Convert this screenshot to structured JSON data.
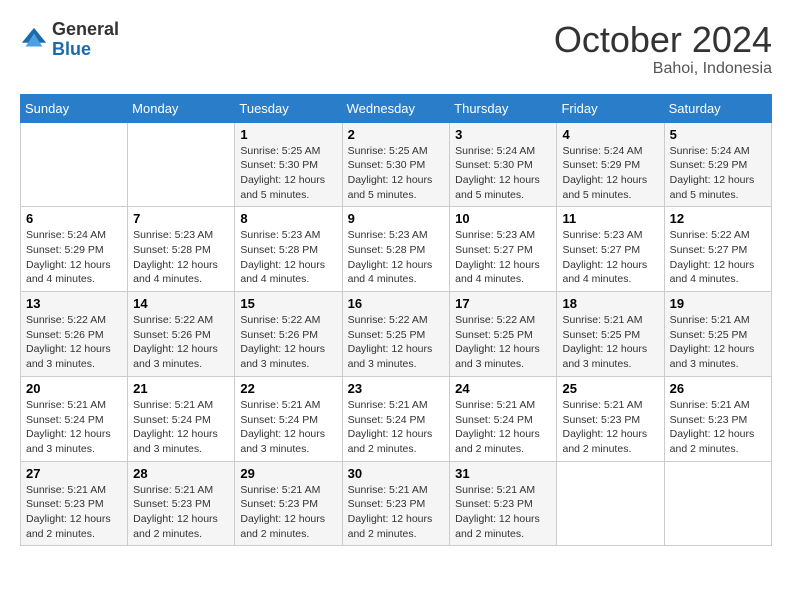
{
  "header": {
    "logo_general": "General",
    "logo_blue": "Blue",
    "month_title": "October 2024",
    "location": "Bahoi, Indonesia"
  },
  "weekdays": [
    "Sunday",
    "Monday",
    "Tuesday",
    "Wednesday",
    "Thursday",
    "Friday",
    "Saturday"
  ],
  "weeks": [
    [
      {
        "day": "",
        "info": ""
      },
      {
        "day": "",
        "info": ""
      },
      {
        "day": "1",
        "info": "Sunrise: 5:25 AM\nSunset: 5:30 PM\nDaylight: 12 hours and 5 minutes."
      },
      {
        "day": "2",
        "info": "Sunrise: 5:25 AM\nSunset: 5:30 PM\nDaylight: 12 hours and 5 minutes."
      },
      {
        "day": "3",
        "info": "Sunrise: 5:24 AM\nSunset: 5:30 PM\nDaylight: 12 hours and 5 minutes."
      },
      {
        "day": "4",
        "info": "Sunrise: 5:24 AM\nSunset: 5:29 PM\nDaylight: 12 hours and 5 minutes."
      },
      {
        "day": "5",
        "info": "Sunrise: 5:24 AM\nSunset: 5:29 PM\nDaylight: 12 hours and 5 minutes."
      }
    ],
    [
      {
        "day": "6",
        "info": "Sunrise: 5:24 AM\nSunset: 5:29 PM\nDaylight: 12 hours and 4 minutes."
      },
      {
        "day": "7",
        "info": "Sunrise: 5:23 AM\nSunset: 5:28 PM\nDaylight: 12 hours and 4 minutes."
      },
      {
        "day": "8",
        "info": "Sunrise: 5:23 AM\nSunset: 5:28 PM\nDaylight: 12 hours and 4 minutes."
      },
      {
        "day": "9",
        "info": "Sunrise: 5:23 AM\nSunset: 5:28 PM\nDaylight: 12 hours and 4 minutes."
      },
      {
        "day": "10",
        "info": "Sunrise: 5:23 AM\nSunset: 5:27 PM\nDaylight: 12 hours and 4 minutes."
      },
      {
        "day": "11",
        "info": "Sunrise: 5:23 AM\nSunset: 5:27 PM\nDaylight: 12 hours and 4 minutes."
      },
      {
        "day": "12",
        "info": "Sunrise: 5:22 AM\nSunset: 5:27 PM\nDaylight: 12 hours and 4 minutes."
      }
    ],
    [
      {
        "day": "13",
        "info": "Sunrise: 5:22 AM\nSunset: 5:26 PM\nDaylight: 12 hours and 3 minutes."
      },
      {
        "day": "14",
        "info": "Sunrise: 5:22 AM\nSunset: 5:26 PM\nDaylight: 12 hours and 3 minutes."
      },
      {
        "day": "15",
        "info": "Sunrise: 5:22 AM\nSunset: 5:26 PM\nDaylight: 12 hours and 3 minutes."
      },
      {
        "day": "16",
        "info": "Sunrise: 5:22 AM\nSunset: 5:25 PM\nDaylight: 12 hours and 3 minutes."
      },
      {
        "day": "17",
        "info": "Sunrise: 5:22 AM\nSunset: 5:25 PM\nDaylight: 12 hours and 3 minutes."
      },
      {
        "day": "18",
        "info": "Sunrise: 5:21 AM\nSunset: 5:25 PM\nDaylight: 12 hours and 3 minutes."
      },
      {
        "day": "19",
        "info": "Sunrise: 5:21 AM\nSunset: 5:25 PM\nDaylight: 12 hours and 3 minutes."
      }
    ],
    [
      {
        "day": "20",
        "info": "Sunrise: 5:21 AM\nSunset: 5:24 PM\nDaylight: 12 hours and 3 minutes."
      },
      {
        "day": "21",
        "info": "Sunrise: 5:21 AM\nSunset: 5:24 PM\nDaylight: 12 hours and 3 minutes."
      },
      {
        "day": "22",
        "info": "Sunrise: 5:21 AM\nSunset: 5:24 PM\nDaylight: 12 hours and 3 minutes."
      },
      {
        "day": "23",
        "info": "Sunrise: 5:21 AM\nSunset: 5:24 PM\nDaylight: 12 hours and 2 minutes."
      },
      {
        "day": "24",
        "info": "Sunrise: 5:21 AM\nSunset: 5:24 PM\nDaylight: 12 hours and 2 minutes."
      },
      {
        "day": "25",
        "info": "Sunrise: 5:21 AM\nSunset: 5:23 PM\nDaylight: 12 hours and 2 minutes."
      },
      {
        "day": "26",
        "info": "Sunrise: 5:21 AM\nSunset: 5:23 PM\nDaylight: 12 hours and 2 minutes."
      }
    ],
    [
      {
        "day": "27",
        "info": "Sunrise: 5:21 AM\nSunset: 5:23 PM\nDaylight: 12 hours and 2 minutes."
      },
      {
        "day": "28",
        "info": "Sunrise: 5:21 AM\nSunset: 5:23 PM\nDaylight: 12 hours and 2 minutes."
      },
      {
        "day": "29",
        "info": "Sunrise: 5:21 AM\nSunset: 5:23 PM\nDaylight: 12 hours and 2 minutes."
      },
      {
        "day": "30",
        "info": "Sunrise: 5:21 AM\nSunset: 5:23 PM\nDaylight: 12 hours and 2 minutes."
      },
      {
        "day": "31",
        "info": "Sunrise: 5:21 AM\nSunset: 5:23 PM\nDaylight: 12 hours and 2 minutes."
      },
      {
        "day": "",
        "info": ""
      },
      {
        "day": "",
        "info": ""
      }
    ]
  ]
}
